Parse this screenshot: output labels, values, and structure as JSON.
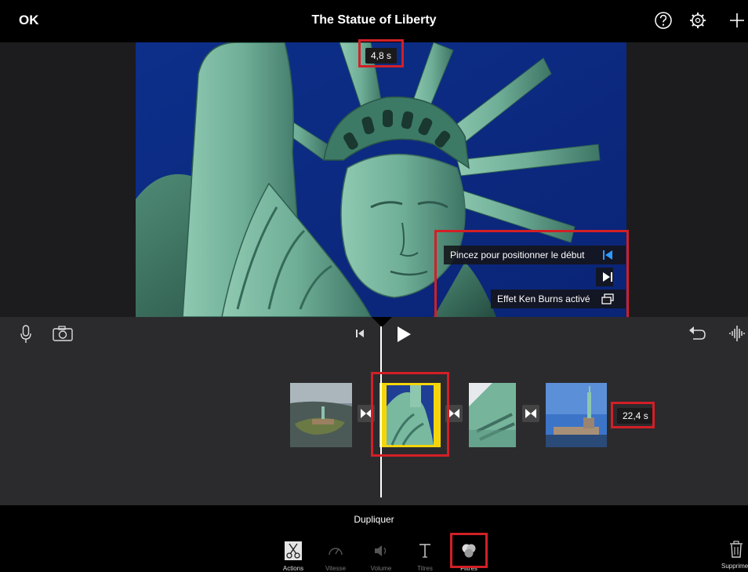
{
  "header": {
    "ok_label": "OK",
    "title": "The Statue of Liberty"
  },
  "viewer": {
    "current_time": "4,8 s",
    "tooltips": {
      "start": "Pincez pour positionner le début",
      "ken_burns": "Effet Ken Burns activé"
    }
  },
  "timeline": {
    "duration": "22,4 s"
  },
  "bottom": {
    "context_label": "Dupliquer",
    "tools": [
      "Actions",
      "Vitesse",
      "Volume",
      "Titres",
      "Filtres"
    ],
    "delete_label": "Supprimer"
  },
  "colors": {
    "highlight": "#d21f26",
    "selection": "#f5d50a",
    "accent": "#2f9bff"
  }
}
